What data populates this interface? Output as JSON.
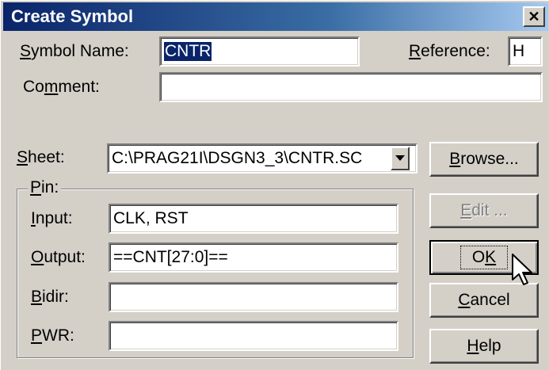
{
  "window": {
    "title": "Create Symbol"
  },
  "labels": {
    "symbol_name_pre": "S",
    "symbol_name_post": "ymbol Name:",
    "reference_pre": "R",
    "reference_post": "eference:",
    "comment_pre": "Co",
    "comment_u": "m",
    "comment_post": "ment:",
    "sheet_u": "S",
    "sheet_post": "heet:",
    "pin_u": "P",
    "pin_post": "in:",
    "input_u": "I",
    "input_post": "nput:",
    "output_u": "O",
    "output_post": "utput:",
    "bidir_u": "B",
    "bidir_post": "idir:",
    "pwr_u": "P",
    "pwr_post": "WR:"
  },
  "fields": {
    "symbol_name": "CNTR",
    "reference": "H",
    "comment": "",
    "sheet": "C:\\PRAG21I\\DSGN3_3\\CNTR.SC",
    "input": "CLK, RST",
    "output": "==CNT[27:0]==",
    "bidir": "",
    "pwr": ""
  },
  "buttons": {
    "browse_u": "B",
    "browse_post": "rowse...",
    "edit_u": "E",
    "edit_post": "dit ...",
    "ok_pre": "O",
    "ok_u": "K",
    "cancel_u": "C",
    "cancel_post": "ancel",
    "help_u": "H",
    "help_post": "elp"
  },
  "colors": {
    "titlebar": "#0a246a",
    "selection": "#0a246a",
    "face": "#d4d0c8"
  },
  "icons": {
    "close": "close-icon",
    "dropdown": "chevron-down-icon",
    "cursor": "mouse-pointer-icon"
  }
}
